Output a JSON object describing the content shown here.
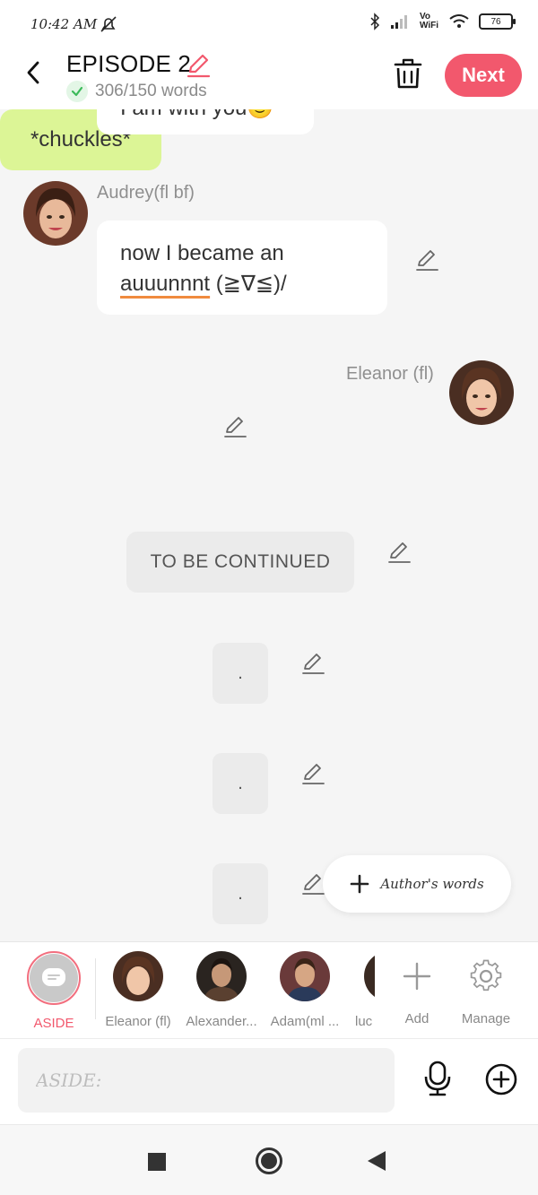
{
  "status_bar": {
    "time": "10:42 AM",
    "wifi_label": "Vo WiFi",
    "battery": "76"
  },
  "header": {
    "title": "EPISODE 2",
    "words": "306/150 words",
    "next_label": "Next"
  },
  "chat": {
    "partial_text": "I am with you🙂",
    "messages": [
      {
        "speaker": "Audrey(fl bf)",
        "text_plain": "now I became an",
        "text_underlined": "auuunnnt",
        "text_tail": " (≧∇≦)/"
      },
      {
        "speaker": "Eleanor (fl)",
        "text": "*chuckles*"
      }
    ],
    "to_be_continued": "TO BE CONTINUED",
    "dot_bubbles": [
      ".",
      ".",
      "."
    ],
    "author_words_label": "Author's words"
  },
  "characters": {
    "aside_label": "ASIDE",
    "items": [
      {
        "label": "Eleanor (fl)"
      },
      {
        "label": "Alexander..."
      },
      {
        "label": "Adam(ml ..."
      },
      {
        "label": "luc"
      }
    ],
    "add_label": "Add",
    "manage_label": "Manage"
  },
  "input": {
    "placeholder": "ASIDE:"
  },
  "colors": {
    "accent": "#f2586d",
    "green_bubble": "#dcf596",
    "check_green": "#3cba5a"
  }
}
